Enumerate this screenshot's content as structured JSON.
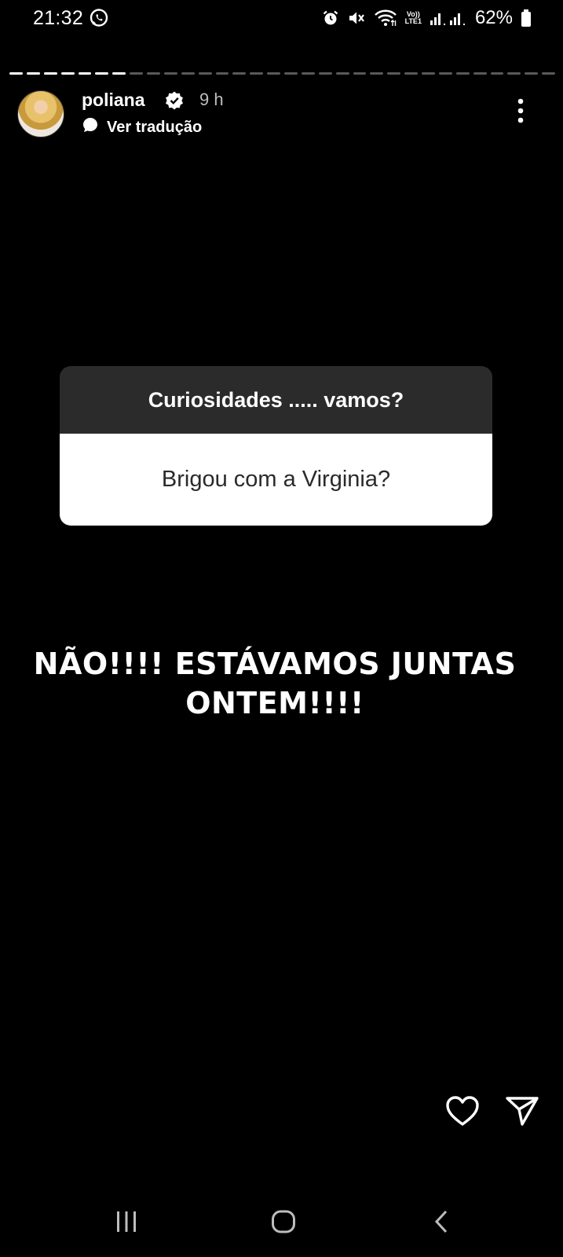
{
  "status_bar": {
    "time": "21:32",
    "lte_top": "Vo))",
    "lte_bottom": "LTE1",
    "battery": "62%"
  },
  "story": {
    "progress_segments": 32,
    "progress_done": 7,
    "username": "poliana",
    "verified": true,
    "time_ago": "9 h",
    "translate_label": "Ver tradução"
  },
  "question_sticker": {
    "title": "Curiosidades ..... vamos?",
    "question": "Brigou com a Virginia?"
  },
  "answer": {
    "line1": "NÃO!!!! ESTÁVAMOS JUNTAS",
    "line2": "ONTEM!!!!"
  },
  "icons": {
    "whatsapp": "whatsapp-icon",
    "alarm": "alarm-icon",
    "mute": "mute-icon",
    "wifi": "wifi-icon",
    "signal": "signal-icon",
    "battery": "battery-icon",
    "verified": "verified-badge-icon",
    "translate": "translate-bubble-icon",
    "more": "more-vertical-icon",
    "like": "heart-icon",
    "share": "send-icon",
    "recent": "recent-apps-icon",
    "home": "home-icon",
    "back": "back-icon"
  },
  "colors": {
    "background": "#000000",
    "sticker_header": "#2b2b2b",
    "sticker_body": "#ffffff"
  }
}
